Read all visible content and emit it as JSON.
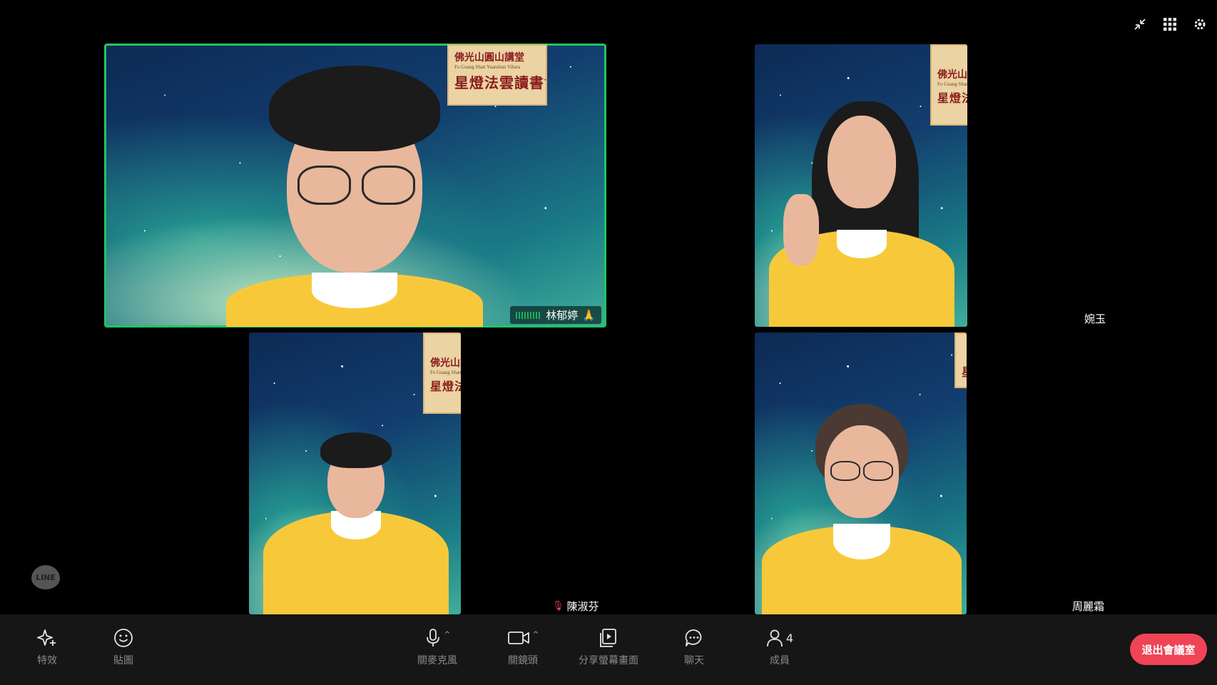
{
  "stage": {
    "participants": [
      {
        "name": "林郁婷",
        "emoji": "🙏",
        "speaking": true
      },
      {
        "name": "婉玉"
      },
      {
        "name": "陳淑芬",
        "mic": "muted"
      },
      {
        "name": "周麗霜"
      }
    ],
    "banner": {
      "top": "佛光山圓山講堂",
      "sub": "Fo Guang Shan Yuanshan Vihara",
      "main": "星燈法雲讀書會"
    },
    "line_badge": "LINE"
  },
  "top_controls": {
    "icons": [
      "collapse-icon",
      "grid-view-icon",
      "settings-icon"
    ]
  },
  "toolbar": {
    "effects": "特效",
    "stickers": "貼圖",
    "mic": "關麥克風",
    "camera": "關鏡頭",
    "share": "分享螢幕畫面",
    "chat": "聊天",
    "members": "成員",
    "member_count": "4",
    "leave": "退出會議室"
  },
  "colors": {
    "active_speaker": "#22c55e",
    "leave_button": "#ef4456",
    "shirt": "#f7c93a"
  }
}
